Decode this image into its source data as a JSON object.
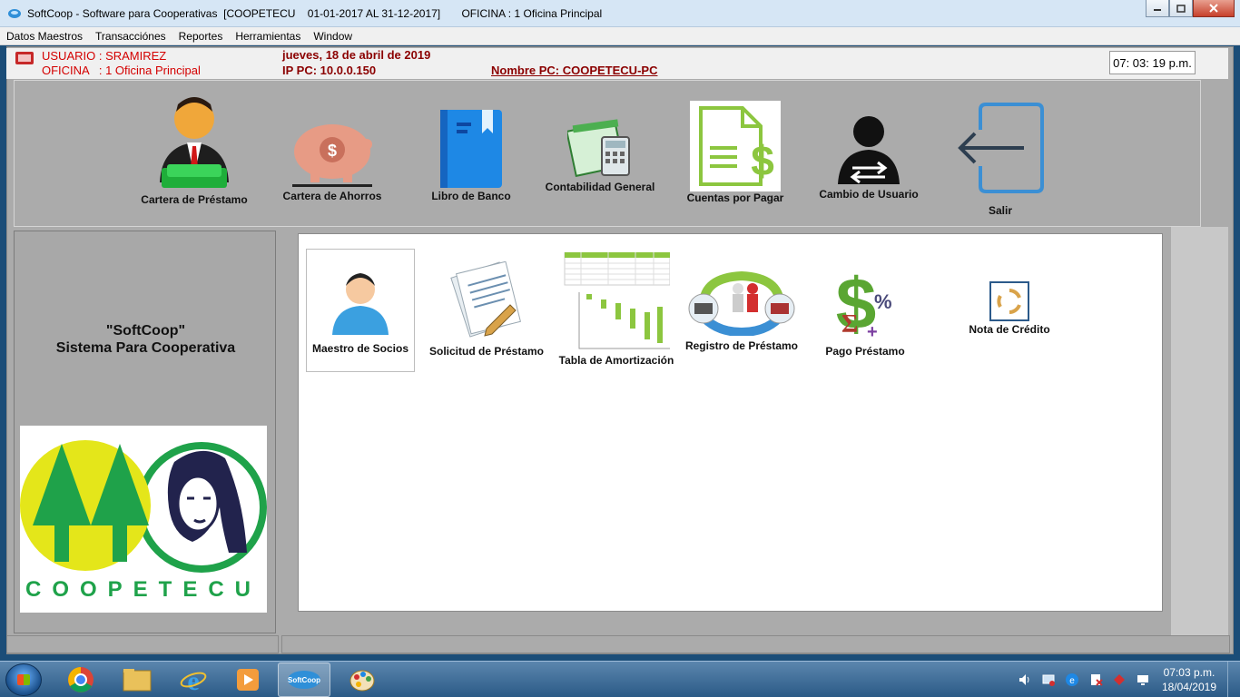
{
  "window": {
    "title": "SoftCoop - Software para Cooperativas  [COOPETECU    01-01-2017 AL 31-12-2017]       OFICINA : 1 Oficina Principal",
    "minimize": "▭",
    "maximize": "▢",
    "close": "✕"
  },
  "menu": {
    "items": [
      "Datos Maestros",
      "Transacciónes",
      "Reportes",
      "Herramientas",
      "Window"
    ]
  },
  "info": {
    "usuario": "USUARIO : SRAMIREZ",
    "oficina": "OFICINA   : 1 Oficina Principal",
    "fecha": "jueves,  18 de abril de 2019",
    "ip": "IP PC: 10.0.0.150",
    "nombre_pc": "Nombre PC: COOPETECU-PC",
    "reloj": "07: 03: 19 p.m."
  },
  "toolbar": {
    "cartera_prestamo": "Cartera de Préstamo",
    "cartera_ahorros": "Cartera de Ahorros",
    "libro_banco": "Libro de Banco",
    "contabilidad": "Contabilidad General",
    "cuentas_pagar": "Cuentas por Pagar",
    "cambio_usuario": "Cambio de Usuario",
    "salir": "Salir"
  },
  "left_panel": {
    "line1": "\"SoftCoop\"",
    "line2": "Sistema Para Cooperativa",
    "logo_text": "COOPETECU"
  },
  "content": {
    "maestro_socios": "Maestro de Socios",
    "solicitud_prestamo": "Solicitud de Préstamo",
    "tabla_amortizacion": "Tabla de Amortización",
    "registro_prestamo": "Registro de Préstamo",
    "pago_prestamo": "Pago Préstamo",
    "nota_credito": "Nota de Crédito"
  },
  "taskbar": {
    "time": "07:03 p.m.",
    "date": "18/04/2019",
    "softcoop_label": "SoftCoop"
  },
  "colors": {
    "accent_red": "#d40000",
    "dark_red": "#8b0000",
    "panel_gray": "#ababab"
  }
}
